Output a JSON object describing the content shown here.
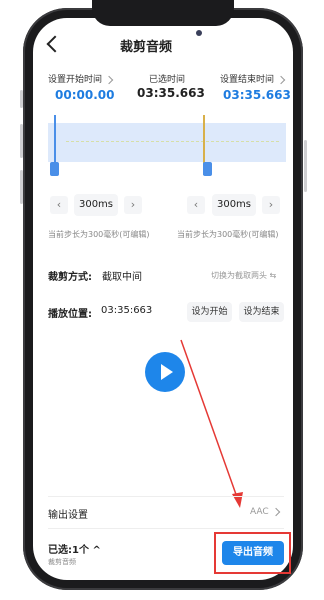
{
  "header": {
    "title": "裁剪音频"
  },
  "times": {
    "start_label": "设置开始时间",
    "start_value": "00:00.00",
    "selected_label": "已选时间",
    "selected_value": "03:35.663",
    "end_label": "设置结束时间",
    "end_value": "03:35.663"
  },
  "steppers": {
    "left": {
      "value": "300ms",
      "hint": "当前步长为300毫秒(可编辑)"
    },
    "right": {
      "value": "300ms",
      "hint": "当前步长为300毫秒(可编辑)"
    }
  },
  "trim_mode": {
    "label": "裁剪方式:",
    "value": "截取中间",
    "switch_label": "切换为截取两头"
  },
  "playback": {
    "label": "播放位置:",
    "value": "03:35:663",
    "set_start": "设为开始",
    "set_end": "设为结束"
  },
  "output": {
    "label": "输出设置",
    "format": "AAC"
  },
  "footer": {
    "selected": "已选:1个",
    "sub": "裁剪音频",
    "export": "导出音频"
  },
  "colors": {
    "accent": "#1e86ea",
    "highlight": "#e53935",
    "selection": "#dde9fb"
  }
}
